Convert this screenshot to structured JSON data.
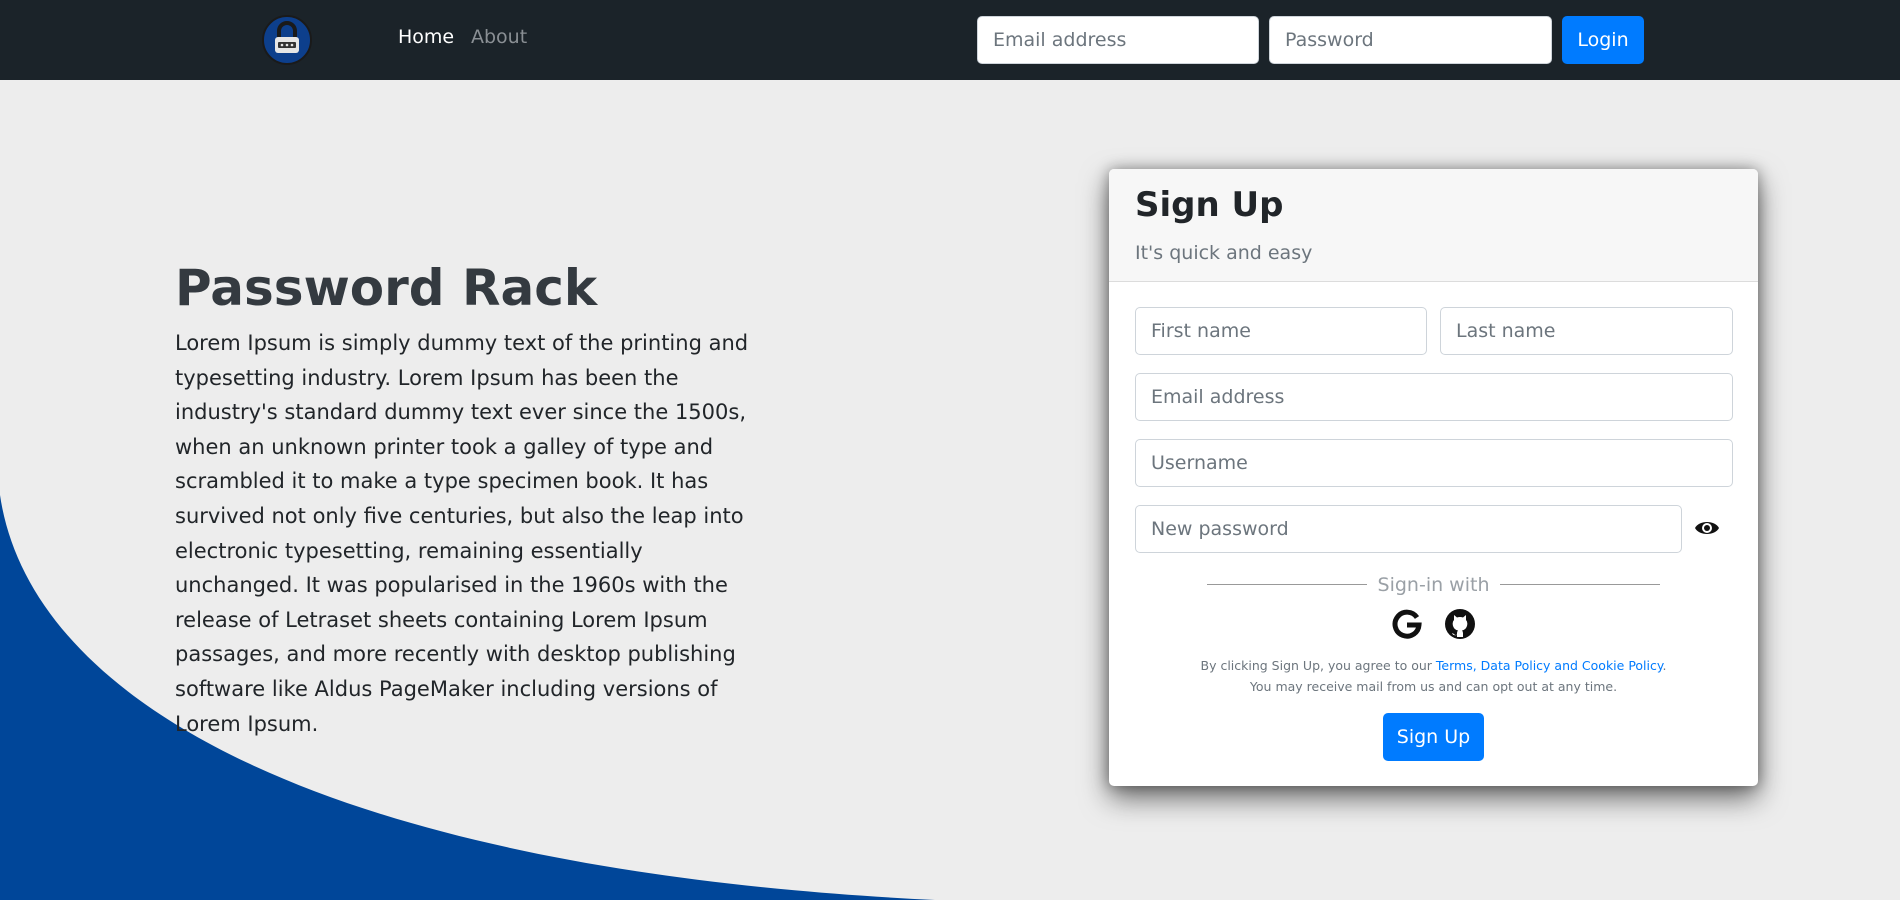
{
  "nav": {
    "logo_icon": "lock-robot-logo-icon",
    "home": "Home",
    "about": "About",
    "email_placeholder": "Email address",
    "password_placeholder": "Password",
    "login": "Login"
  },
  "hero": {
    "title": "Password Rack",
    "body": "Lorem Ipsum is simply dummy text of the printing and typesetting industry. Lorem Ipsum has been the industry's standard dummy text ever since the 1500s, when an unknown printer took a galley of type and scrambled it to make a type specimen book. It has survived not only five centuries, but also the leap into electronic typesetting, remaining essentially unchanged. It was popularised in the 1960s with the release of Letraset sheets containing Lorem Ipsum passages, and more recently with desktop publishing software like Aldus PageMaker including versions of Lorem Ipsum."
  },
  "signup": {
    "title": "Sign Up",
    "subtitle": "It's quick and easy",
    "first_name_placeholder": "First name",
    "last_name_placeholder": "Last name",
    "email_placeholder": "Email address",
    "username_placeholder": "Username",
    "password_placeholder": "New password",
    "show_password_icon": "eye-icon",
    "signin_with": "Sign-in with",
    "social_icons": [
      "google-icon",
      "github-icon"
    ],
    "terms_prefix": "By clicking Sign Up, you agree to our ",
    "terms_link": "Terms, Data Policy and Cookie Policy",
    "terms_suffix": ".",
    "terms_line2": "You may receive mail from us and can opt out at any time.",
    "submit": "Sign Up"
  },
  "colors": {
    "navbar": "#1b2329",
    "background": "#ededed",
    "wave": "#004699",
    "primary": "#007bff",
    "heading": "#343a40"
  }
}
